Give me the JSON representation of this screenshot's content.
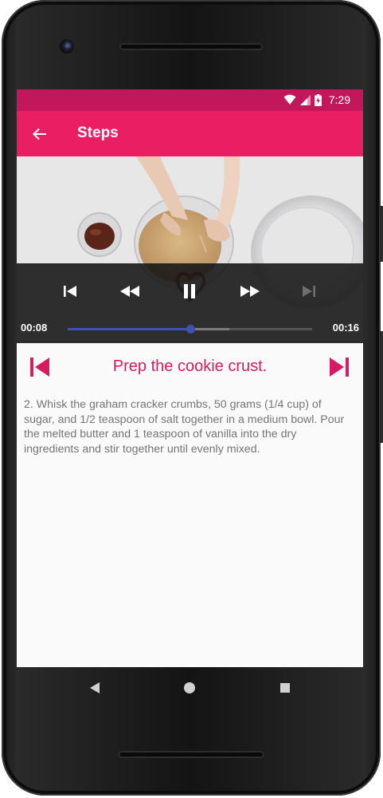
{
  "colors": {
    "status_bar": "#c2185b",
    "app_bar": "#e91e63",
    "accent": "#d81b60",
    "seek_played": "#3f51b5",
    "description_text": "#757575"
  },
  "status_bar": {
    "time": "7:29",
    "icons": [
      "wifi-icon",
      "cell-signal-icon",
      "battery-charging-icon"
    ]
  },
  "app_bar": {
    "title": "Steps",
    "back_icon": "arrow-back-icon"
  },
  "player": {
    "elapsed": "00:08",
    "duration": "00:16",
    "progress_fraction": 0.5,
    "buffered_fraction": 0.66,
    "state": "playing",
    "controls": [
      "skip-previous-icon",
      "rewind-icon",
      "pause-icon",
      "fast-forward-icon",
      "skip-next-icon"
    ],
    "skip_next_enabled": false
  },
  "step": {
    "title": "Prep the cookie crust.",
    "description": "2. Whisk the graham cracker crumbs, 50 grams (1/4 cup) of sugar, and 1/2 teaspoon of salt together in a medium bowl. Pour the melted butter and 1 teaspoon of vanilla into the dry ingredients and stir together until evenly mixed.",
    "prev_icon": "skip-previous-icon",
    "next_icon": "skip-next-icon"
  },
  "system_nav": [
    "back-triangle-icon",
    "home-circle-icon",
    "recents-square-icon"
  ]
}
